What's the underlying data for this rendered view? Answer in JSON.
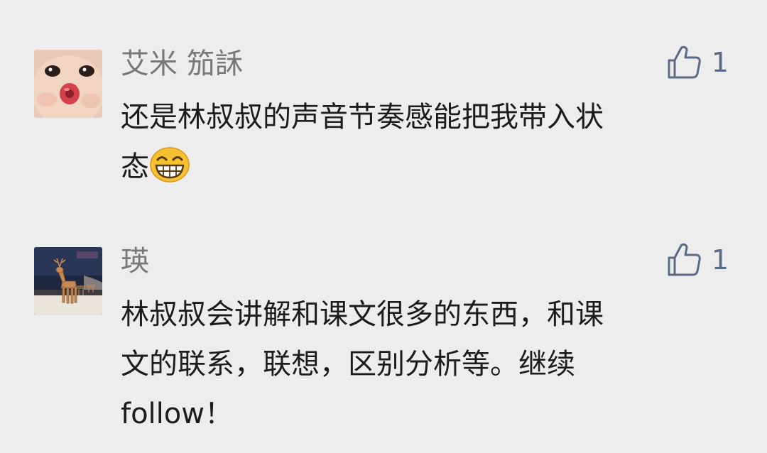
{
  "comments": [
    {
      "nickname": "艾米 笳訸",
      "likes": "1",
      "text_line1": "还是林叔叔的声音节奏感能把我带入状",
      "text_line2": "态",
      "emoji": "grinning-face-emoji",
      "avatar": "baby-face-avatar",
      "like_icon": "thumbs-up-icon"
    },
    {
      "nickname": "瑛",
      "likes": "1",
      "text_line1": "林叔叔会讲解和课文很多的东西，和课",
      "text_line2": "文的联系，联想，区别分析等。继续",
      "text_line3": "follow！",
      "avatar": "deer-figurine-avatar",
      "like_icon": "thumbs-up-icon"
    }
  ],
  "colors": {
    "background": "#ededed",
    "nickname": "#787878",
    "like_accent": "#5d6a84",
    "text": "#1c1c1c"
  }
}
